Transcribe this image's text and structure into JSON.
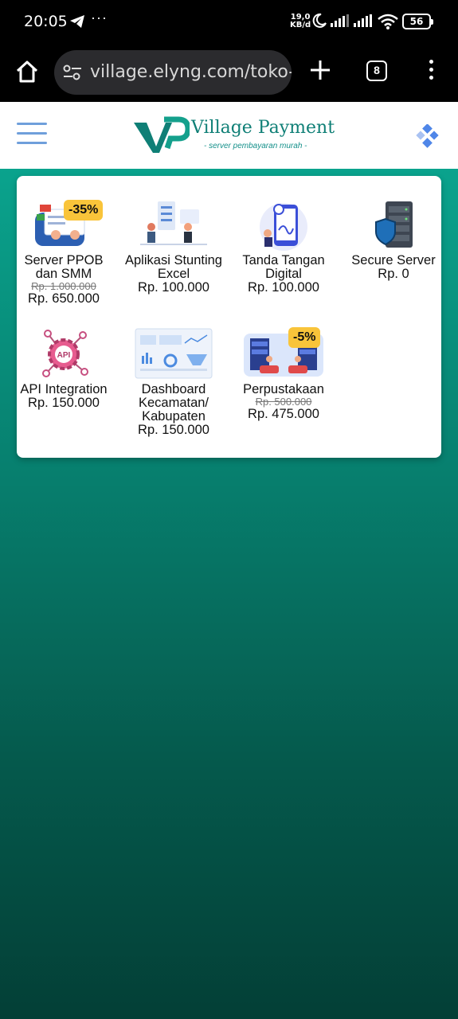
{
  "status_bar": {
    "time": "20:05",
    "net_speed_value": "19,0",
    "net_speed_unit": "KB/d",
    "battery": "56"
  },
  "browser": {
    "url": "village.elyng.com/toko-i",
    "tab_count": "8"
  },
  "site": {
    "brand_title": "Village Payment",
    "brand_subtitle": "- server pembayaran murah -",
    "colors": {
      "brand": "#0f7f76",
      "accent_blue": "#3f7fcf",
      "badge": "#f9c43a"
    }
  },
  "products": [
    {
      "name": "Server PPOB dan SMM",
      "old_price": "Rp. 1.000.000",
      "price": "Rp. 650.000",
      "badge": "-35%",
      "icon": "payment-illustration"
    },
    {
      "name": "Aplikasi Stunting Excel",
      "price": "Rp. 100.000",
      "icon": "office-illustration"
    },
    {
      "name": "Tanda Tangan Digital",
      "price": "Rp. 100.000",
      "icon": "e-signature-illustration"
    },
    {
      "name": "Secure Server",
      "price": "Rp. 0",
      "icon": "server-shield-illustration"
    },
    {
      "name": "API Integration",
      "price": "Rp. 150.000",
      "icon": "api-gear-illustration"
    },
    {
      "name": "Dashboard Kecamatan/ Kabupaten",
      "price": "Rp. 150.000",
      "icon": "dashboard-illustration"
    },
    {
      "name": "Perpustakaan",
      "old_price": "Rp. 500.000",
      "price": "Rp. 475.000",
      "badge": "-5%",
      "icon": "library-illustration"
    }
  ]
}
